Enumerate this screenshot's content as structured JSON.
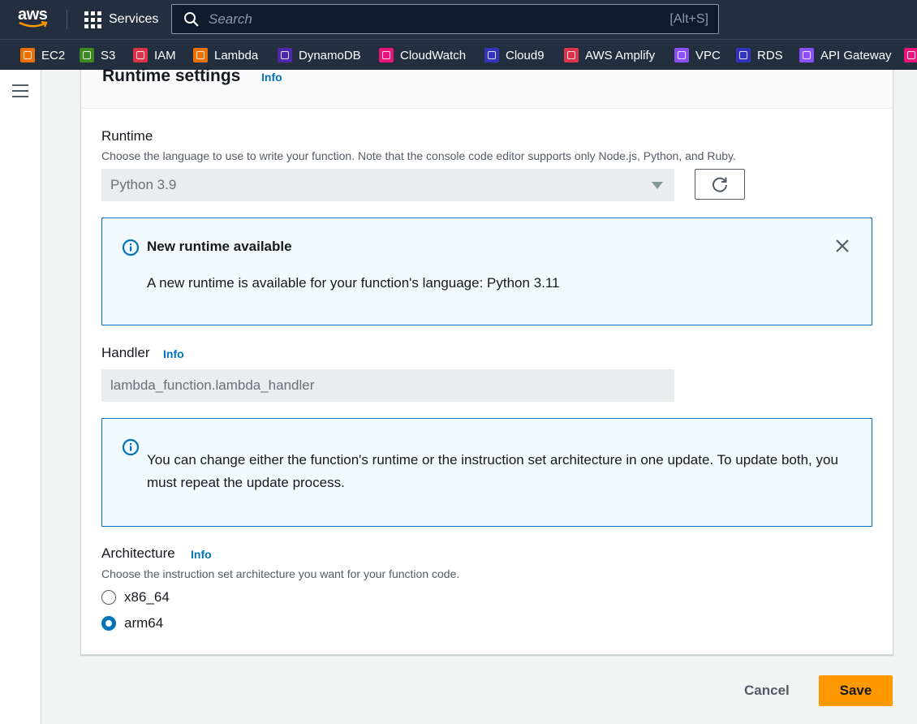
{
  "topnav": {
    "logo_text": "aws",
    "services_label": "Services",
    "search_placeholder": "Search",
    "search_shortcut": "[Alt+S]"
  },
  "favorites": [
    {
      "label": "EC2",
      "color": "#ed7100"
    },
    {
      "label": "S3",
      "color": "#3f8624"
    },
    {
      "label": "IAM",
      "color": "#dd344c"
    },
    {
      "label": "Lambda",
      "color": "#ed7100"
    },
    {
      "label": "DynamoDB",
      "color": "#4d27aa"
    },
    {
      "label": "CloudWatch",
      "color": "#e7157b"
    },
    {
      "label": "Cloud9",
      "color": "#3334b9"
    },
    {
      "label": "AWS Amplify",
      "color": "#dd344c"
    },
    {
      "label": "VPC",
      "color": "#8c4fff"
    },
    {
      "label": "RDS",
      "color": "#3334b9"
    },
    {
      "label": "API Gateway",
      "color": "#8c4fff"
    },
    {
      "label": "",
      "color": "#e7157b"
    }
  ],
  "panel": {
    "title": "Runtime settings",
    "info": "Info"
  },
  "runtime": {
    "label": "Runtime",
    "description": "Choose the language to use to write your function. Note that the console code editor supports only Node.js, Python, and Ruby.",
    "selected": "Python 3.9"
  },
  "runtime_alert": {
    "title": "New runtime available",
    "body": "A new runtime is available for your function's language: Python 3.11"
  },
  "handler": {
    "label": "Handler",
    "info": "Info",
    "value": "lambda_function.lambda_handler"
  },
  "update_alert": {
    "body": "You can change either the function's runtime or the instruction set architecture in one update. To update both, you must repeat the update process."
  },
  "architecture": {
    "label": "Architecture",
    "info": "Info",
    "description": "Choose the instruction set architecture you want for your function code.",
    "options": [
      {
        "label": "x86_64",
        "checked": false
      },
      {
        "label": "arm64",
        "checked": true
      }
    ]
  },
  "actions": {
    "cancel": "Cancel",
    "save": "Save"
  },
  "colors": {
    "nav_bg": "#232f3e",
    "accent": "#0073bb",
    "primary_button": "#ff9900"
  }
}
